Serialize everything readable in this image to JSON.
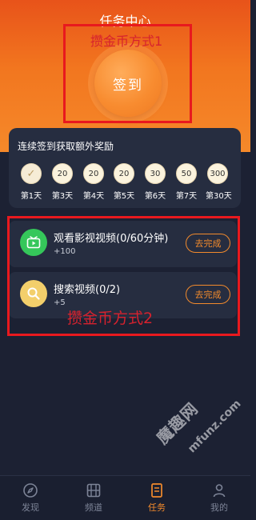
{
  "header": {
    "title": "任务中心"
  },
  "checkin": {
    "button_label": "签到"
  },
  "annotations": {
    "method1": "攒金币方式1",
    "method2": "攒金币方式2"
  },
  "reward": {
    "title": "连续签到获取额外奖励",
    "days": [
      {
        "coin": "✓",
        "label": "第1天",
        "done": true
      },
      {
        "coin": "20",
        "label": "第3天"
      },
      {
        "coin": "20",
        "label": "第4天"
      },
      {
        "coin": "20",
        "label": "第5天"
      },
      {
        "coin": "30",
        "label": "第6天"
      },
      {
        "coin": "50",
        "label": "第7天"
      },
      {
        "coin": "300",
        "label": "第30天"
      }
    ]
  },
  "tasks": [
    {
      "title": "观看影视视频(0/60分钟)",
      "reward": "+100",
      "button": "去完成",
      "icon": "tv-icon",
      "color": "#35c75a"
    },
    {
      "title": "搜索视频(0/2)",
      "reward": "+5",
      "button": "去完成",
      "icon": "search-icon",
      "color": "#f3cf6b"
    }
  ],
  "watermark": {
    "main": "魔趣网",
    "sub": "mfunz.com"
  },
  "tabbar": [
    {
      "label": "发现",
      "icon": "compass-icon",
      "active": false
    },
    {
      "label": "频道",
      "icon": "film-icon",
      "active": false
    },
    {
      "label": "任务",
      "icon": "task-list-icon",
      "active": true
    },
    {
      "label": "我的",
      "icon": "user-icon",
      "active": false
    }
  ],
  "colors": {
    "accent": "#f28a2c",
    "header": "#f2761f",
    "annotation": "#e8191e",
    "background": "#1c2133"
  }
}
